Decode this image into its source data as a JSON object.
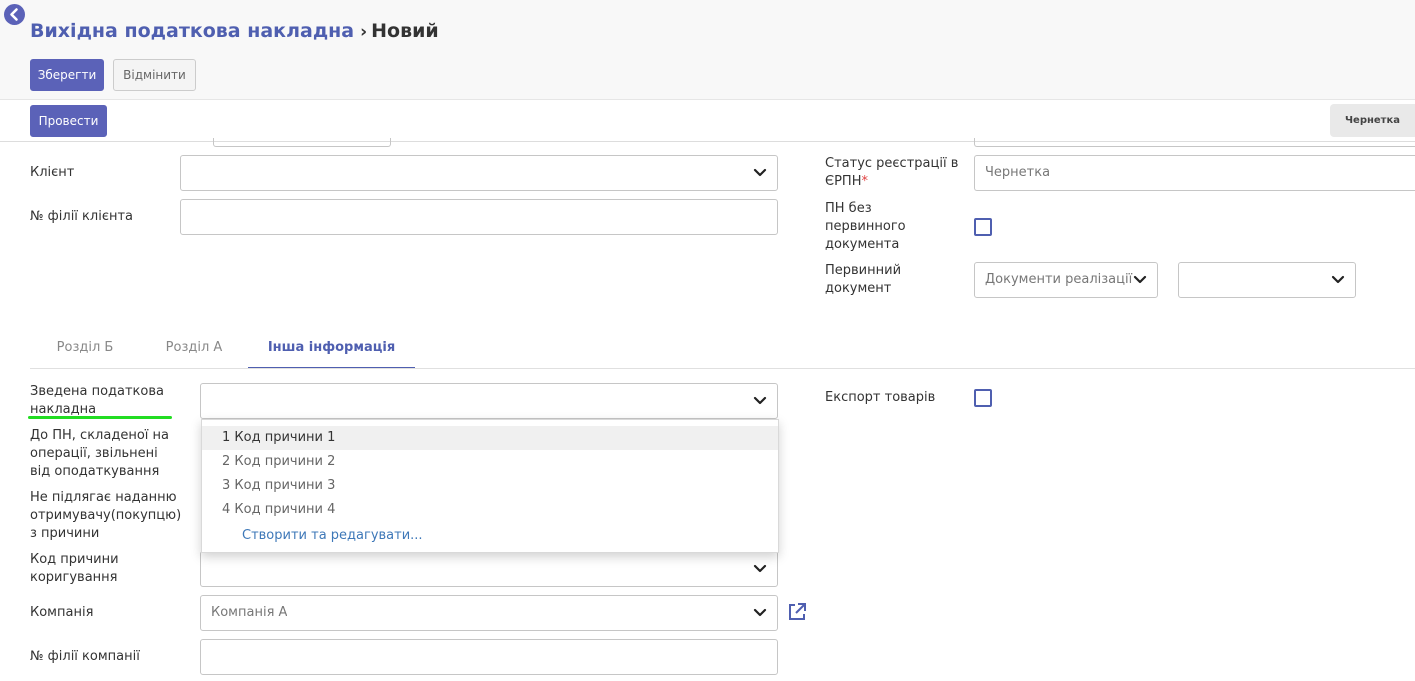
{
  "header": {
    "breadcrumb": "Вихідна податкова накладна",
    "separator": "›",
    "current": "Новий",
    "save_label": "Зберегти",
    "discard_label": "Відмінити"
  },
  "statusbar": {
    "post_label": "Провести",
    "state": "Чернетка"
  },
  "form": {
    "client_label": "Клієнт",
    "client_value": "",
    "client_branch_label": "№ філії клієнта",
    "client_branch_value": "",
    "erpn_status_label": "Статус реєстрації в ЄРПН",
    "erpn_required_mark": "*",
    "erpn_status_value": "Чернетка",
    "no_primary_doc_label": "ПН без первинного документа",
    "primary_doc_label": "Первинний документ",
    "primary_doc_type": "Документи реалізації",
    "primary_doc_value": ""
  },
  "tabs": [
    {
      "label": "Розділ Б"
    },
    {
      "label": "Розділ А"
    },
    {
      "label": "Інша інформація"
    }
  ],
  "other_info": {
    "consolidated_label": "Зведена податкова накладна",
    "exempt_label": "До ПН, складеної на операції, звільнені від оподаткування",
    "not_issued_label": "Не підлягає наданню отримувачу(покупцю) з причини",
    "correction_code_label": "Код причини коригування",
    "company_label": "Компанія",
    "company_value": "Компанія А",
    "company_branch_label": "№ філії компанії",
    "export_label": "Експорт товарів"
  },
  "dropdown": {
    "options": [
      {
        "label": "1 Код причини 1"
      },
      {
        "label": "2 Код причини 2"
      },
      {
        "label": "3 Код причини 3"
      },
      {
        "label": "4 Код причини 4"
      }
    ],
    "create_label": "Створити та редагувати..."
  },
  "colors": {
    "primary": "#5b62b8",
    "link": "#3e78b8",
    "required": "#e04040",
    "annotation": "#22dd22"
  },
  "icons": {
    "back": "chevron-left-circle-icon",
    "dropdown": "chevron-down-icon",
    "external": "external-link-icon"
  }
}
